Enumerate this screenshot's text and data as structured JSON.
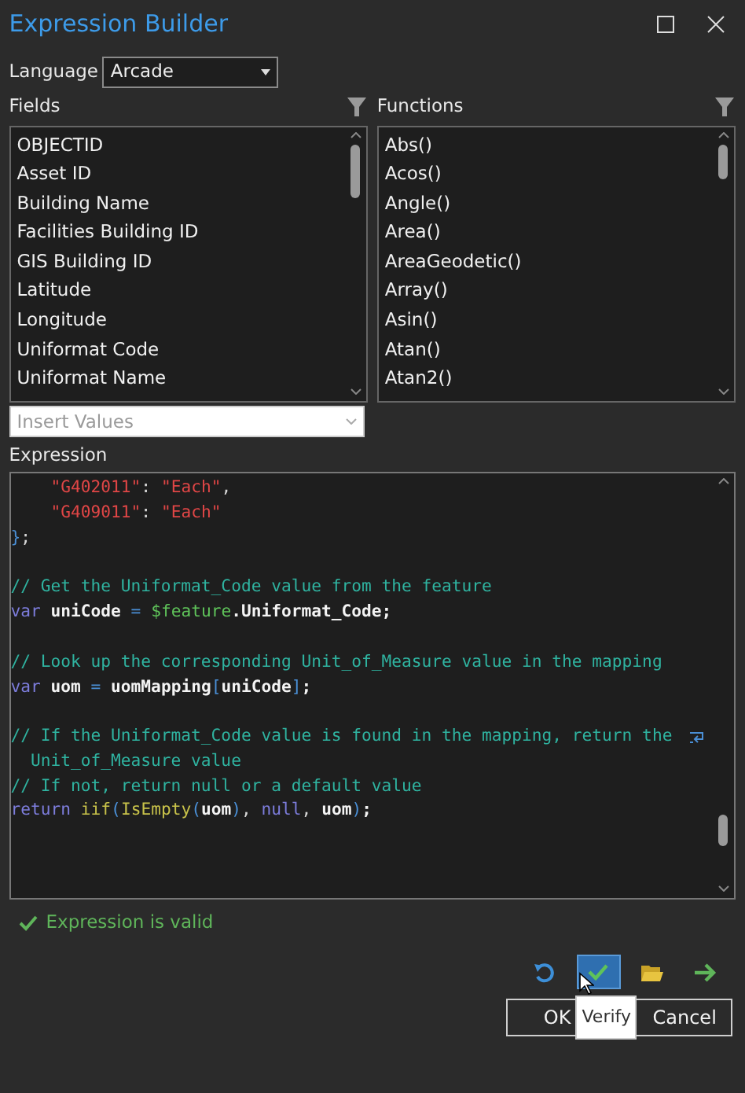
{
  "window": {
    "title": "Expression Builder"
  },
  "language": {
    "label": "Language",
    "value": "Arcade"
  },
  "fields": {
    "label": "Fields",
    "items": [
      "OBJECTID",
      "Asset ID",
      "Building Name",
      "Facilities Building ID",
      "GIS Building ID",
      "Latitude",
      "Longitude",
      "Uniformat Code",
      "Uniformat Name"
    ]
  },
  "functions": {
    "label": "Functions",
    "items": [
      "Abs()",
      "Acos()",
      "Angle()",
      "Area()",
      "AreaGeodetic()",
      "Array()",
      "Asin()",
      "Atan()",
      "Atan2()"
    ]
  },
  "insert_values": {
    "placeholder": "Insert Values",
    "disabled": true
  },
  "expression": {
    "label": "Expression",
    "lines": [
      {
        "tokens": [
          {
            "kind": "string",
            "text": "    \"G402011\""
          },
          {
            "kind": "plain",
            "text": ": "
          },
          {
            "kind": "string",
            "text": "\"Each\""
          },
          {
            "kind": "plain",
            "text": ","
          }
        ]
      },
      {
        "tokens": [
          {
            "kind": "string",
            "text": "    \"G409011\""
          },
          {
            "kind": "plain",
            "text": ": "
          },
          {
            "kind": "string",
            "text": "\"Each\""
          }
        ]
      },
      {
        "tokens": [
          {
            "kind": "punct",
            "text": "}"
          },
          {
            "kind": "plain",
            "text": ";"
          }
        ]
      },
      {
        "blank_before": true,
        "tokens": [
          {
            "kind": "comment",
            "text": "// Get the Uniformat_Code value from the feature"
          }
        ]
      },
      {
        "tokens": [
          {
            "kind": "keyword",
            "text": "var"
          },
          {
            "kind": "ident",
            "text": " uniCode "
          },
          {
            "kind": "punct",
            "text": "="
          },
          {
            "kind": "global",
            "text": " $feature"
          },
          {
            "kind": "ident",
            "text": ".Uniformat_Code;"
          }
        ]
      },
      {
        "blank_before": true,
        "tokens": [
          {
            "kind": "comment",
            "text": "// Look up the corresponding Unit_of_Measure value in the mapping"
          }
        ]
      },
      {
        "tokens": [
          {
            "kind": "keyword",
            "text": "var"
          },
          {
            "kind": "ident",
            "text": " uom "
          },
          {
            "kind": "punct",
            "text": "="
          },
          {
            "kind": "ident",
            "text": " uomMapping"
          },
          {
            "kind": "punct",
            "text": "["
          },
          {
            "kind": "ident",
            "text": "uniCode"
          },
          {
            "kind": "punct",
            "text": "]"
          },
          {
            "kind": "ident",
            "text": ";"
          }
        ]
      },
      {
        "blank_before": true,
        "wrapped": true,
        "tokens": [
          {
            "kind": "comment",
            "text": "// If the Uniformat_Code value is found in the mapping, return the"
          }
        ]
      },
      {
        "tokens": [
          {
            "kind": "comment",
            "text": "  Unit_of_Measure value"
          }
        ]
      },
      {
        "tokens": [
          {
            "kind": "comment",
            "text": "// If not, return null or a default value"
          }
        ]
      },
      {
        "tokens": [
          {
            "kind": "keyword",
            "text": "return"
          },
          {
            "kind": "func",
            "text": " iif"
          },
          {
            "kind": "punct",
            "text": "("
          },
          {
            "kind": "func",
            "text": "IsEmpty"
          },
          {
            "kind": "punct",
            "text": "("
          },
          {
            "kind": "ident",
            "text": "uom"
          },
          {
            "kind": "punct",
            "text": ")"
          },
          {
            "kind": "plain",
            "text": ", "
          },
          {
            "kind": "keyword",
            "text": "null"
          },
          {
            "kind": "plain",
            "text": ", "
          },
          {
            "kind": "ident",
            "text": "uom"
          },
          {
            "kind": "punct",
            "text": ")"
          },
          {
            "kind": "ident",
            "text": ";"
          }
        ]
      }
    ]
  },
  "status": {
    "message": "Expression is valid",
    "valid": true
  },
  "toolbar": [
    {
      "kind": "undo",
      "selected": false
    },
    {
      "kind": "verify",
      "selected": true
    },
    {
      "kind": "open",
      "selected": false
    },
    {
      "kind": "export",
      "selected": false
    }
  ],
  "tooltip": "Verify",
  "buttons": [
    "OK",
    "Cancel"
  ]
}
